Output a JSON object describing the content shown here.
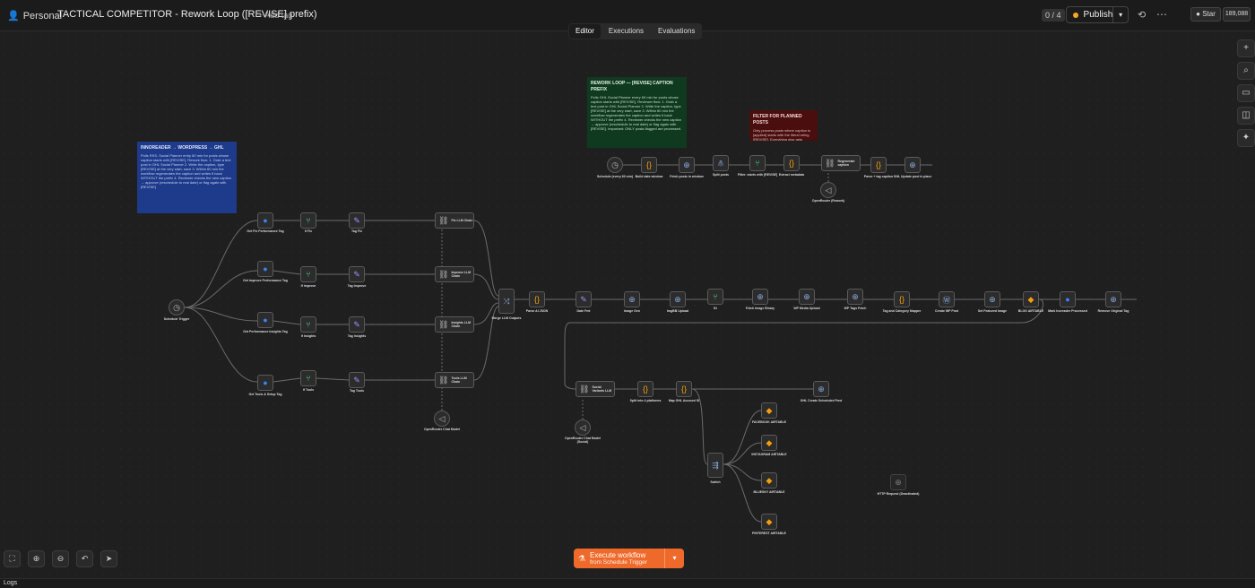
{
  "header": {
    "project": "Personal",
    "title": "TACTICAL COMPETITOR - Rework Loop ([REVISE] prefix)",
    "add_tag": "+ Add tag",
    "counter": "0 / 4",
    "publish": "Publish",
    "star": "Star",
    "star_count": "189,088"
  },
  "tabs": [
    "Editor",
    "Executions",
    "Evaluations"
  ],
  "notes": {
    "blue": {
      "title": "INNOREADER → WORDPRESS → GHL",
      "body": "Pulls RSS, Social Planner entry 60 min for posts whose caption starts with [REVISE]. Rework flow: 1. Grab a text post in GHL Social Planner 2. Write the caption, type [REVISE] at the very start, save 3. Within 60 min the workflow regenerates the caption and writes it back WITHOUT the prefix 4. Reviewer checks the new caption → approve (reschedule to real date) or flag again with [REVISE]"
    },
    "green": {
      "title": "REWORK LOOP — [REVISE] CAPTION PREFIX",
      "body": "Polls GHL Social Planner every 60 min for posts whose caption starts with [REVISE]. Reviewer flow: 1. Grab a text post in GHL Social Planner 2. Write the caption, type [REVISE] at the very start, save 3. Within 60 min the workflow regenerates the caption and writes it back WITHOUT the prefix 4. Reviewer checks the new caption → approve (reschedule to real date) or flag again with [REVISE]. Important: ONLY posts flagged are processed."
    },
    "red": {
      "title": "FILTER FOR PLANNED POSTS",
      "body": "Only process posts where caption is [applied] starts with the literal string [REVISE]. Everything else gets dropped silently."
    }
  },
  "nodes": {
    "schedule_trigger": "Schedule Trigger",
    "get_fix": "Get Fix Performance Tag",
    "get_improve": "Get Improve Performance Tag",
    "get_insights": "Get Performance Insights Tag",
    "get_tools": "Get Tools & Setup Tag",
    "if_fix": "If Fix",
    "if_improve": "If Improve",
    "if_insights": "If Insights",
    "if_tools": "If Tools",
    "tag_fix": "Tag Fix",
    "tag_improve": "Tag Improve",
    "tag_insights": "Tag Insights",
    "tag_tools": "Tag Tools",
    "fix_chain": "Fix LLM Chain",
    "improve_chain": "Improve LLM Chain",
    "insights_chain": "Insights LLM Chain",
    "tools_chain": "Tools LLM Chain",
    "openrouter_model": "OpenRouter Chat Model",
    "merge": "Merge LLM Outputs",
    "parse_json": "Parse AI JSON",
    "date_fmt": "Date Fmt",
    "image_gen": "Image Gen",
    "imgbb": "ImgBB Upload",
    "if1": "If1",
    "fetch_image": "Fetch Image Binary",
    "wp_media": "WP Media Upload",
    "wp_tags": "WP Tags Fetch",
    "tag_category": "Tag and Category Mapper",
    "create_wp": "Create WP Post",
    "set_featured": "Set Featured Image",
    "blog_airtable": "BLOG AIRTABLE",
    "mark_processed": "Mark Inoreader Processed",
    "remove_tag": "Remove Original Tag",
    "social_variants": "Social Variants LLM",
    "openrouter_social": "OpenRouter Chat Model (Social)",
    "split_platforms": "Split into 4 platforms",
    "map_ghl": "Map GHL Account ID",
    "ghl_create": "GHL Create Scheduled Post",
    "switch": "Switch",
    "facebook": "FACEBOOK AIRTABLE",
    "instagram": "INSTAGRAM AIRTABLE",
    "bluesky": "BLUESKY AIRTABLE",
    "pinterest": "PINTEREST AIRTABLE",
    "http_request": "HTTP Request (Deactivated)",
    "schedule_60": "Schedule (every 60 min)",
    "build_window": "Build date window",
    "fetch_posts": "Fetch posts in window",
    "split_posts": "Split posts",
    "filter_revise": "Filter: starts with [REVISE]",
    "extract_metadata": "Extract metadata",
    "regenerate": "Regenerate caption",
    "parse_caption": "Parse + tag caption",
    "ghl_update": "GHL Update post in place",
    "openrouter_rework": "OpenRouter (Rework)"
  },
  "execute": {
    "label": "Execute workflow",
    "sub": "from Schedule Trigger"
  },
  "logs": "Logs",
  "colors": {
    "accent": "#ef6a2a",
    "note_blue": "#1e3a8a",
    "note_green": "#0f3a1f",
    "note_red": "#4a0e0e"
  }
}
